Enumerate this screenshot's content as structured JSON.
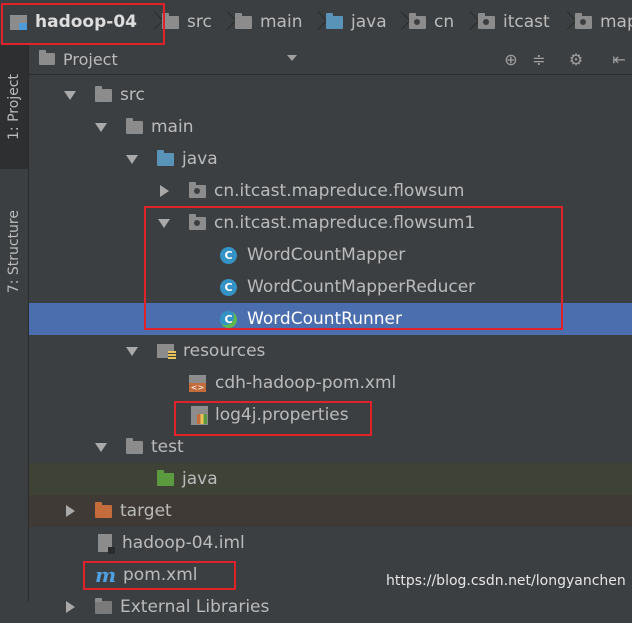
{
  "breadcrumb": {
    "items": [
      {
        "label": "hadoop-04",
        "icon": "module-icon"
      },
      {
        "label": "src",
        "icon": "folder-icon"
      },
      {
        "label": "main",
        "icon": "folder-icon"
      },
      {
        "label": "java",
        "icon": "source-folder-icon"
      },
      {
        "label": "cn",
        "icon": "package-icon"
      },
      {
        "label": "itcast",
        "icon": "package-icon"
      },
      {
        "label": "map",
        "icon": "package-icon"
      }
    ]
  },
  "side_tabs": {
    "project": "1: Project",
    "structure": "7: Structure"
  },
  "panel": {
    "title": "Project",
    "tools": [
      "target-icon",
      "collapse-all-icon",
      "gear-icon",
      "hide-panel-icon"
    ]
  },
  "tree": {
    "src": "src",
    "main": "main",
    "java": "java",
    "pkg_flowsum": "cn.itcast.mapreduce.flowsum",
    "pkg_flowsum1": "cn.itcast.mapreduce.flowsum1",
    "class_mapper": "WordCountMapper",
    "class_reducer": "WordCountMapperReducer",
    "class_runner": "WordCountRunner",
    "class_icon_letter": "C",
    "resources": "resources",
    "pom_resource": "cdh-hadoop-pom.xml",
    "log4j": "log4j.properties",
    "test": "test",
    "test_java": "java",
    "target": "target",
    "iml": "hadoop-04.iml",
    "pom_icon_letter": "m",
    "pom": "pom.xml",
    "external_libs": "External Libraries"
  },
  "watermark": "https://blog.csdn.net/longyanchen",
  "colors": {
    "background": "#3c3f41",
    "selection": "#4b6eaf",
    "annotation_red": "#e0232a",
    "class_icon": "#3592c4",
    "source_folder": "#5a93b8"
  }
}
